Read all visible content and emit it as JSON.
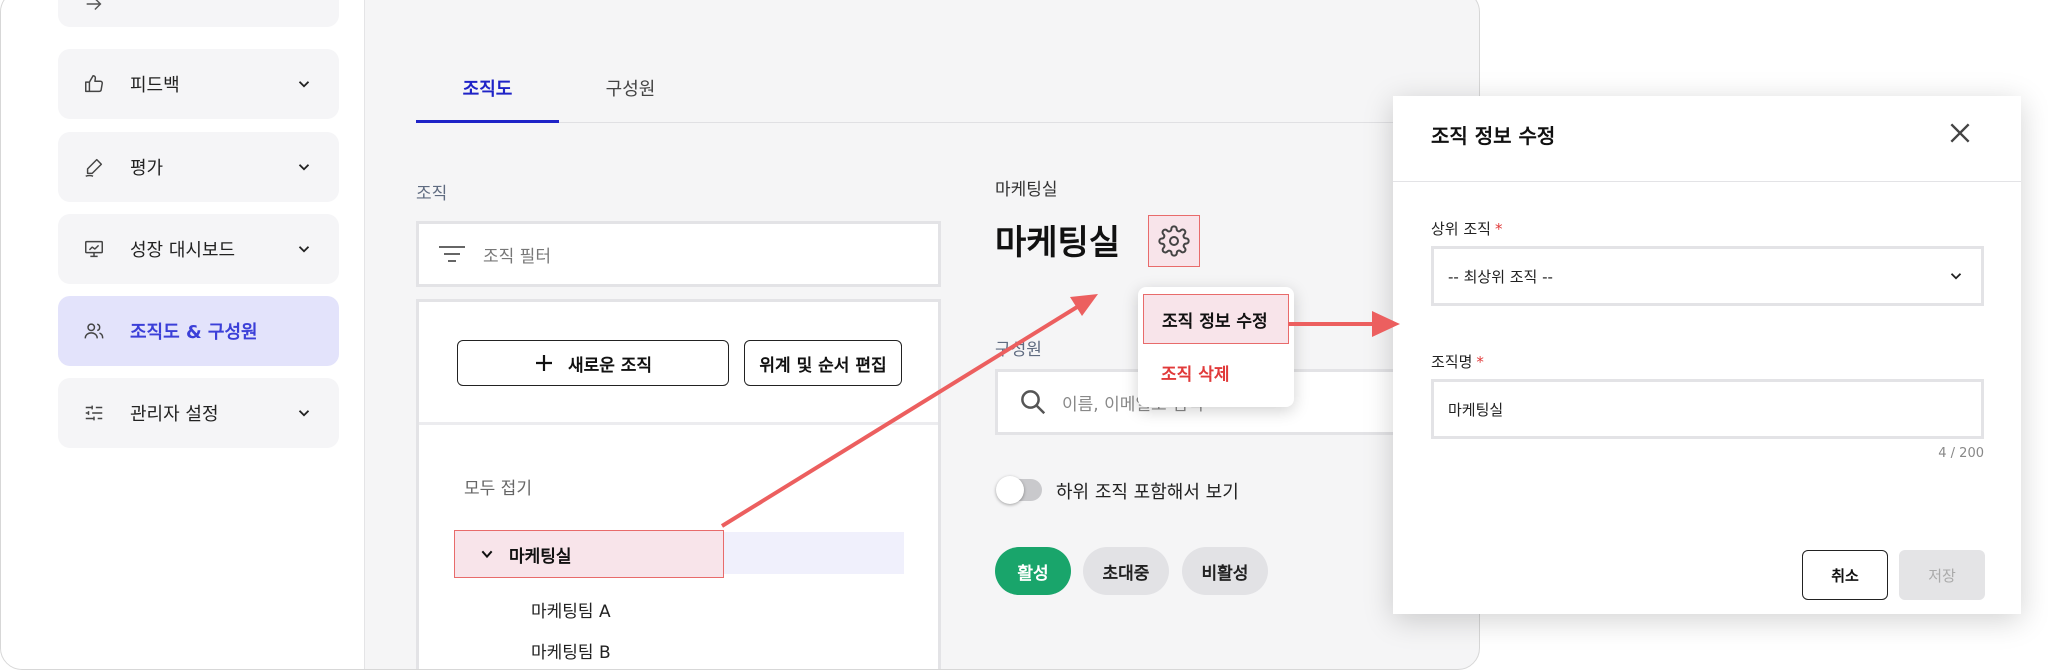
{
  "sidebar": {
    "items": [
      {
        "label": "피드백",
        "icon": "thumbs-up-icon",
        "expandable": true
      },
      {
        "label": "평가",
        "icon": "pen-icon",
        "expandable": true
      },
      {
        "label": "성장 대시보드",
        "icon": "presentation-chart-icon",
        "expandable": true
      },
      {
        "label": "조직도 & 구성원",
        "icon": "users-icon",
        "active": true
      },
      {
        "label": "관리자 설정",
        "icon": "sliders-icon",
        "expandable": true
      }
    ]
  },
  "tabs": [
    {
      "label": "조직도",
      "active": true
    },
    {
      "label": "구성원",
      "active": false
    }
  ],
  "org_panel": {
    "section_label": "조직",
    "filter_placeholder": "조직 필터",
    "new_org_button": "새로운 조직",
    "edit_order_button": "위계 및 순서 편집",
    "collapse_all": "모두 접기",
    "tree": {
      "root": "마케팅실",
      "children": [
        "마케팅팀 A",
        "마케팅팀 B"
      ]
    }
  },
  "detail": {
    "subtitle": "마케팅실",
    "title": "마케팅실",
    "members_label": "구성원",
    "search_placeholder": "이름, 이메일로 검색",
    "toggle_label": "하위 조직 포함해서 보기",
    "toggle_on": false,
    "status_chips": [
      "활성",
      "초대중",
      "비활성"
    ]
  },
  "context_menu": {
    "items": [
      "조직 정보 수정",
      "조직 삭제"
    ]
  },
  "modal": {
    "title": "조직 정보 수정",
    "parent_label": "상위 조직",
    "parent_value": "-- 최상위 조직 --",
    "name_label": "조직명",
    "name_value": "마케팅실",
    "required_mark": "*",
    "char_count": "4 / 200",
    "cancel_button": "취소",
    "save_button": "저장"
  },
  "colors": {
    "accent": "#1f23c7",
    "active_nav_bg": "#e3e3fb",
    "highlight_bg": "#f8e4ea",
    "highlight_border": "#e86b6b",
    "annotation_arrow": "#ec5f5f",
    "success": "#19a56b",
    "danger": "#e13a3a"
  }
}
